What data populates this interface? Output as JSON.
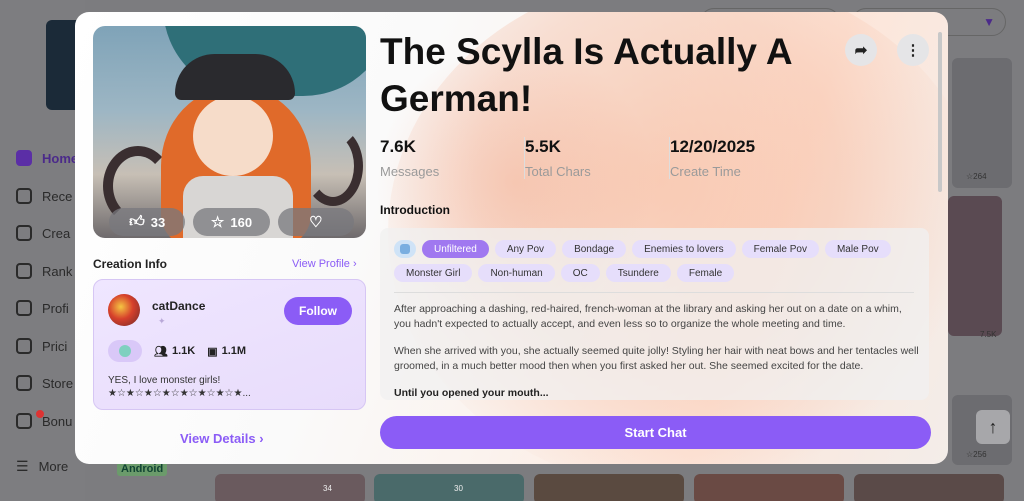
{
  "sidebar": {
    "items": [
      {
        "label": "Home"
      },
      {
        "label": "Rece"
      },
      {
        "label": "Crea"
      },
      {
        "label": "Rank"
      },
      {
        "label": "Profi"
      },
      {
        "label": "Prici"
      },
      {
        "label": "Store"
      },
      {
        "label": "Bonu"
      },
      {
        "label": "More"
      }
    ],
    "android_label": "Android"
  },
  "background": {
    "card_counts": [
      "264",
      "7.5K",
      "256",
      "34",
      "30"
    ]
  },
  "modal": {
    "title": "The Scylla Is Actually A German!",
    "cover_stats": {
      "likes": "33",
      "favorites": "160"
    },
    "creation_info": {
      "heading": "Creation Info",
      "view_profile": "View Profile",
      "creator_name": "catDance",
      "follow_label": "Follow",
      "followers": "1.1K",
      "chats": "1.1M",
      "bio": "YES, I love monster girls! ★☆★☆★☆★☆★☆★☆★☆★..."
    },
    "view_details": "View Details",
    "stats": [
      {
        "value": "7.6K",
        "label": "Messages"
      },
      {
        "value": "5.5K",
        "label": "Total Chars"
      },
      {
        "value": "12/20/2025",
        "label": "Create Time"
      }
    ],
    "intro_heading": "Introduction",
    "tags": [
      "Unfiltered",
      "Any Pov",
      "Bondage",
      "Enemies to lovers",
      "Female Pov",
      "Male Pov",
      "Monster Girl",
      "Non-human",
      "OC",
      "Tsundere",
      "Female"
    ],
    "intro_paragraphs": [
      "After approaching a dashing, red-haired, french-woman at the library and asking her out on a date on a whim, you hadn't expected to actually accept, and even less so to organize the whole meeting and time.",
      "When she arrived with you, she actually seemed quite jolly! Styling her hair with neat bows and her tentacles well groomed, in a much better mood then when you first asked her out. She seemed excited for the date.",
      "Until you opened your mouth..."
    ],
    "start_chat": "Start Chat"
  },
  "colors": {
    "accent": "#8b5cf6",
    "tag_bg": "#e6defb"
  }
}
